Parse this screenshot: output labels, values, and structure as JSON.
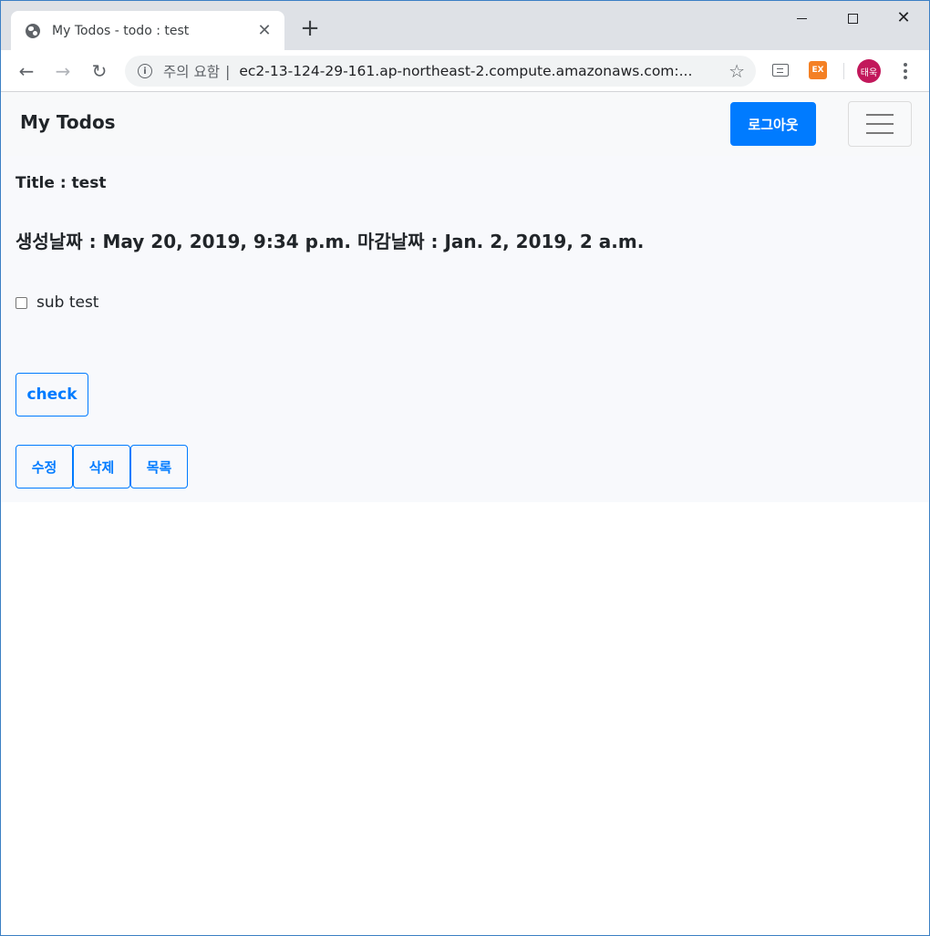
{
  "browser": {
    "tab_title": "My Todos - todo : test",
    "tab_close": "✕",
    "new_tab": "+",
    "security_label": "주의 요함",
    "url_separator": "|",
    "url": "ec2-13-124-29-161.ap-northeast-2.compute.amazonaws.com:...",
    "extension_ex_label": "EX",
    "profile_label": "태욱",
    "icons": {
      "favicon": "globe-icon",
      "back": "arrow-left-icon",
      "forward": "arrow-right-icon",
      "reload": "reload-icon",
      "info": "info-icon",
      "bookmark": "star-icon",
      "menu": "more-vert-icon"
    }
  },
  "navbar": {
    "brand": "My Todos",
    "logout_label": "로그아웃"
  },
  "todo": {
    "title_line": "Title : test",
    "dates_line": "생성날짜 : May 20, 2019, 9:34 p.m. 마감날짜 : Jan. 2, 2019, 2 a.m.",
    "subtask_label": "sub test",
    "subtask_checked": false
  },
  "actions": {
    "check_label": "check",
    "edit_label": "수정",
    "delete_label": "삭제",
    "list_label": "목록"
  },
  "colors": {
    "primary": "#007bff",
    "navbar_bg": "#f8f9fa",
    "browser_frame": "#dee1e6"
  }
}
